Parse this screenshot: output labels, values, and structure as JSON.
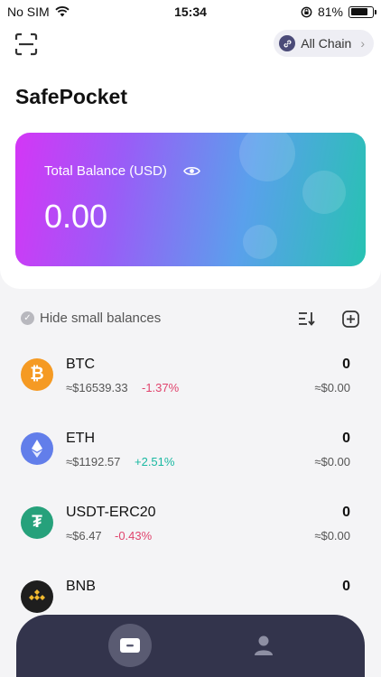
{
  "status_bar": {
    "carrier": "No SIM",
    "time": "15:34",
    "battery": "81%",
    "battery_level": 0.81
  },
  "header": {
    "chain_label": "All Chain",
    "app_title": "SafePocket"
  },
  "balance_card": {
    "label": "Total Balance (USD)",
    "value": "0.00"
  },
  "list": {
    "hide_small_label": "Hide small balances",
    "assets": [
      {
        "symbol": "BTC",
        "price": "≈$16539.33",
        "change": "-1.37%",
        "direction": "down",
        "amount": "0",
        "value": "≈$0.00",
        "color": "#f59a23",
        "icon": "bitcoin-icon"
      },
      {
        "symbol": "ETH",
        "price": "≈$1192.57",
        "change": "+2.51%",
        "direction": "up",
        "amount": "0",
        "value": "≈$0.00",
        "color": "#627eea",
        "icon": "ethereum-icon"
      },
      {
        "symbol": "USDT-ERC20",
        "price": "≈$6.47",
        "change": "-0.43%",
        "direction": "down",
        "amount": "0",
        "value": "≈$0.00",
        "color": "#26a17b",
        "icon": "tether-icon"
      },
      {
        "symbol": "BNB",
        "amount": "0",
        "color": "#1e1e1e",
        "icon": "bnb-icon"
      }
    ]
  },
  "tab_bar": {
    "items": [
      "wallet-icon",
      "profile-icon"
    ]
  },
  "colors": {
    "accent_down": "#e0446d",
    "accent_up": "#19b8a1",
    "tab_bar": "#33344c"
  }
}
